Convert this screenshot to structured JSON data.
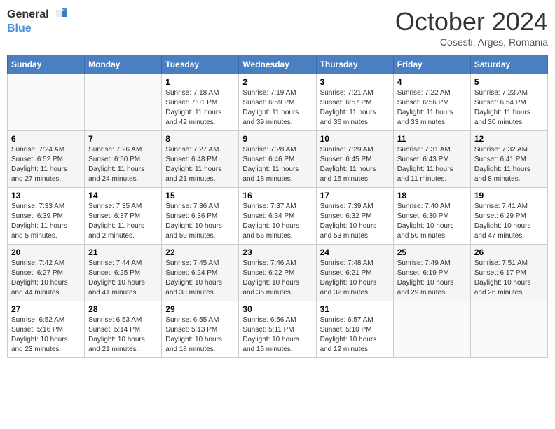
{
  "logo": {
    "line1": "General",
    "line2": "Blue"
  },
  "title": "October 2024",
  "location": "Cosesti, Arges, Romania",
  "weekdays": [
    "Sunday",
    "Monday",
    "Tuesday",
    "Wednesday",
    "Thursday",
    "Friday",
    "Saturday"
  ],
  "weeks": [
    [
      {
        "day": "",
        "sunrise": "",
        "sunset": "",
        "daylight": ""
      },
      {
        "day": "",
        "sunrise": "",
        "sunset": "",
        "daylight": ""
      },
      {
        "day": "1",
        "sunrise": "Sunrise: 7:18 AM",
        "sunset": "Sunset: 7:01 PM",
        "daylight": "Daylight: 11 hours and 42 minutes."
      },
      {
        "day": "2",
        "sunrise": "Sunrise: 7:19 AM",
        "sunset": "Sunset: 6:59 PM",
        "daylight": "Daylight: 11 hours and 39 minutes."
      },
      {
        "day": "3",
        "sunrise": "Sunrise: 7:21 AM",
        "sunset": "Sunset: 6:57 PM",
        "daylight": "Daylight: 11 hours and 36 minutes."
      },
      {
        "day": "4",
        "sunrise": "Sunrise: 7:22 AM",
        "sunset": "Sunset: 6:56 PM",
        "daylight": "Daylight: 11 hours and 33 minutes."
      },
      {
        "day": "5",
        "sunrise": "Sunrise: 7:23 AM",
        "sunset": "Sunset: 6:54 PM",
        "daylight": "Daylight: 11 hours and 30 minutes."
      }
    ],
    [
      {
        "day": "6",
        "sunrise": "Sunrise: 7:24 AM",
        "sunset": "Sunset: 6:52 PM",
        "daylight": "Daylight: 11 hours and 27 minutes."
      },
      {
        "day": "7",
        "sunrise": "Sunrise: 7:26 AM",
        "sunset": "Sunset: 6:50 PM",
        "daylight": "Daylight: 11 hours and 24 minutes."
      },
      {
        "day": "8",
        "sunrise": "Sunrise: 7:27 AM",
        "sunset": "Sunset: 6:48 PM",
        "daylight": "Daylight: 11 hours and 21 minutes."
      },
      {
        "day": "9",
        "sunrise": "Sunrise: 7:28 AM",
        "sunset": "Sunset: 6:46 PM",
        "daylight": "Daylight: 11 hours and 18 minutes."
      },
      {
        "day": "10",
        "sunrise": "Sunrise: 7:29 AM",
        "sunset": "Sunset: 6:45 PM",
        "daylight": "Daylight: 11 hours and 15 minutes."
      },
      {
        "day": "11",
        "sunrise": "Sunrise: 7:31 AM",
        "sunset": "Sunset: 6:43 PM",
        "daylight": "Daylight: 11 hours and 11 minutes."
      },
      {
        "day": "12",
        "sunrise": "Sunrise: 7:32 AM",
        "sunset": "Sunset: 6:41 PM",
        "daylight": "Daylight: 11 hours and 8 minutes."
      }
    ],
    [
      {
        "day": "13",
        "sunrise": "Sunrise: 7:33 AM",
        "sunset": "Sunset: 6:39 PM",
        "daylight": "Daylight: 11 hours and 5 minutes."
      },
      {
        "day": "14",
        "sunrise": "Sunrise: 7:35 AM",
        "sunset": "Sunset: 6:37 PM",
        "daylight": "Daylight: 11 hours and 2 minutes."
      },
      {
        "day": "15",
        "sunrise": "Sunrise: 7:36 AM",
        "sunset": "Sunset: 6:36 PM",
        "daylight": "Daylight: 10 hours and 59 minutes."
      },
      {
        "day": "16",
        "sunrise": "Sunrise: 7:37 AM",
        "sunset": "Sunset: 6:34 PM",
        "daylight": "Daylight: 10 hours and 56 minutes."
      },
      {
        "day": "17",
        "sunrise": "Sunrise: 7:39 AM",
        "sunset": "Sunset: 6:32 PM",
        "daylight": "Daylight: 10 hours and 53 minutes."
      },
      {
        "day": "18",
        "sunrise": "Sunrise: 7:40 AM",
        "sunset": "Sunset: 6:30 PM",
        "daylight": "Daylight: 10 hours and 50 minutes."
      },
      {
        "day": "19",
        "sunrise": "Sunrise: 7:41 AM",
        "sunset": "Sunset: 6:29 PM",
        "daylight": "Daylight: 10 hours and 47 minutes."
      }
    ],
    [
      {
        "day": "20",
        "sunrise": "Sunrise: 7:42 AM",
        "sunset": "Sunset: 6:27 PM",
        "daylight": "Daylight: 10 hours and 44 minutes."
      },
      {
        "day": "21",
        "sunrise": "Sunrise: 7:44 AM",
        "sunset": "Sunset: 6:25 PM",
        "daylight": "Daylight: 10 hours and 41 minutes."
      },
      {
        "day": "22",
        "sunrise": "Sunrise: 7:45 AM",
        "sunset": "Sunset: 6:24 PM",
        "daylight": "Daylight: 10 hours and 38 minutes."
      },
      {
        "day": "23",
        "sunrise": "Sunrise: 7:46 AM",
        "sunset": "Sunset: 6:22 PM",
        "daylight": "Daylight: 10 hours and 35 minutes."
      },
      {
        "day": "24",
        "sunrise": "Sunrise: 7:48 AM",
        "sunset": "Sunset: 6:21 PM",
        "daylight": "Daylight: 10 hours and 32 minutes."
      },
      {
        "day": "25",
        "sunrise": "Sunrise: 7:49 AM",
        "sunset": "Sunset: 6:19 PM",
        "daylight": "Daylight: 10 hours and 29 minutes."
      },
      {
        "day": "26",
        "sunrise": "Sunrise: 7:51 AM",
        "sunset": "Sunset: 6:17 PM",
        "daylight": "Daylight: 10 hours and 26 minutes."
      }
    ],
    [
      {
        "day": "27",
        "sunrise": "Sunrise: 6:52 AM",
        "sunset": "Sunset: 5:16 PM",
        "daylight": "Daylight: 10 hours and 23 minutes."
      },
      {
        "day": "28",
        "sunrise": "Sunrise: 6:53 AM",
        "sunset": "Sunset: 5:14 PM",
        "daylight": "Daylight: 10 hours and 21 minutes."
      },
      {
        "day": "29",
        "sunrise": "Sunrise: 6:55 AM",
        "sunset": "Sunset: 5:13 PM",
        "daylight": "Daylight: 10 hours and 18 minutes."
      },
      {
        "day": "30",
        "sunrise": "Sunrise: 6:56 AM",
        "sunset": "Sunset: 5:11 PM",
        "daylight": "Daylight: 10 hours and 15 minutes."
      },
      {
        "day": "31",
        "sunrise": "Sunrise: 6:57 AM",
        "sunset": "Sunset: 5:10 PM",
        "daylight": "Daylight: 10 hours and 12 minutes."
      },
      {
        "day": "",
        "sunrise": "",
        "sunset": "",
        "daylight": ""
      },
      {
        "day": "",
        "sunrise": "",
        "sunset": "",
        "daylight": ""
      }
    ]
  ]
}
